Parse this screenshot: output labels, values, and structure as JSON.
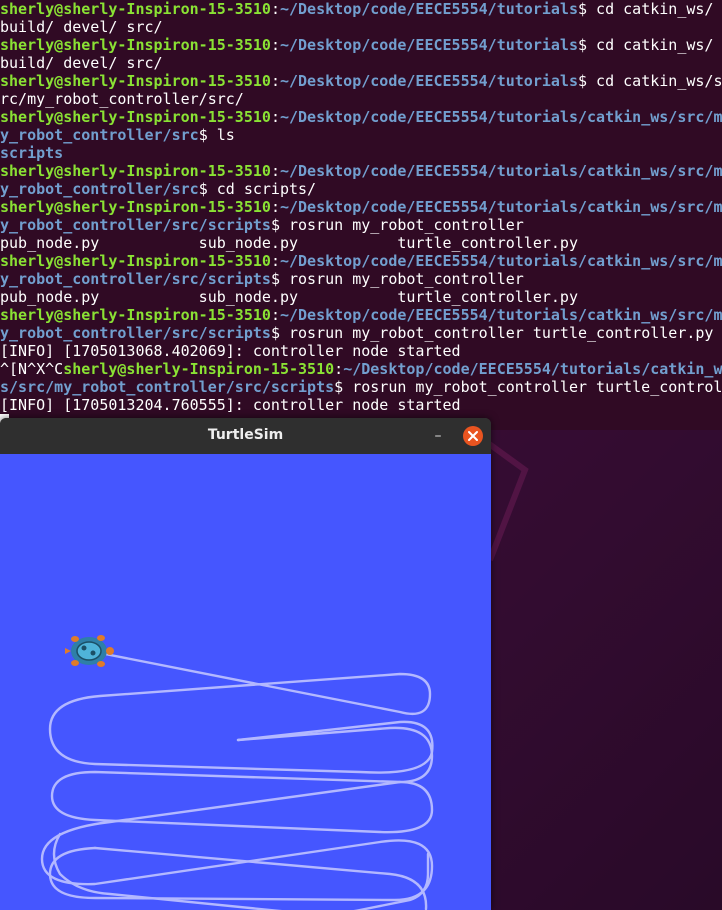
{
  "terminal": {
    "prompt_user": "sherly@sherly-Inspiron-15-3510",
    "lines": [
      [
        {
          "t": "sherly@sherly-Inspiron-15-3510",
          "c": "user"
        },
        {
          "t": ":",
          "c": "plain"
        },
        {
          "t": "~/Desktop/code/EECE5554/tutorials",
          "c": "path"
        },
        {
          "t": "$ cd catkin_ws/",
          "c": "plain"
        }
      ],
      [
        {
          "t": "build/ devel/ src/",
          "c": "plain"
        }
      ],
      [
        {
          "t": "sherly@sherly-Inspiron-15-3510",
          "c": "user"
        },
        {
          "t": ":",
          "c": "plain"
        },
        {
          "t": "~/Desktop/code/EECE5554/tutorials",
          "c": "path"
        },
        {
          "t": "$ cd catkin_ws/",
          "c": "plain"
        }
      ],
      [
        {
          "t": "build/ devel/ src/",
          "c": "plain"
        }
      ],
      [
        {
          "t": "sherly@sherly-Inspiron-15-3510",
          "c": "user"
        },
        {
          "t": ":",
          "c": "plain"
        },
        {
          "t": "~/Desktop/code/EECE5554/tutorials",
          "c": "path"
        },
        {
          "t": "$ cd catkin_ws/s",
          "c": "plain"
        }
      ],
      [
        {
          "t": "rc/my_robot_controller/src/",
          "c": "plain"
        }
      ],
      [
        {
          "t": "sherly@sherly-Inspiron-15-3510",
          "c": "user"
        },
        {
          "t": ":",
          "c": "plain"
        },
        {
          "t": "~/Desktop/code/EECE5554/tutorials/catkin_ws/src/m",
          "c": "path"
        }
      ],
      [
        {
          "t": "y_robot_controller/src",
          "c": "path"
        },
        {
          "t": "$ ls",
          "c": "plain"
        }
      ],
      [
        {
          "t": "scripts",
          "c": "dir"
        }
      ],
      [
        {
          "t": "sherly@sherly-Inspiron-15-3510",
          "c": "user"
        },
        {
          "t": ":",
          "c": "plain"
        },
        {
          "t": "~/Desktop/code/EECE5554/tutorials/catkin_ws/src/m",
          "c": "path"
        }
      ],
      [
        {
          "t": "y_robot_controller/src",
          "c": "path"
        },
        {
          "t": "$ cd scripts/",
          "c": "plain"
        }
      ],
      [
        {
          "t": "sherly@sherly-Inspiron-15-3510",
          "c": "user"
        },
        {
          "t": ":",
          "c": "plain"
        },
        {
          "t": "~/Desktop/code/EECE5554/tutorials/catkin_ws/src/m",
          "c": "path"
        }
      ],
      [
        {
          "t": "y_robot_controller/src/scripts",
          "c": "path"
        },
        {
          "t": "$ rosrun my_robot_controller",
          "c": "plain"
        }
      ],
      [
        {
          "t": "pub_node.py           sub_node.py           turtle_controller.py",
          "c": "plain"
        }
      ],
      [
        {
          "t": "sherly@sherly-Inspiron-15-3510",
          "c": "user"
        },
        {
          "t": ":",
          "c": "plain"
        },
        {
          "t": "~/Desktop/code/EECE5554/tutorials/catkin_ws/src/m",
          "c": "path"
        }
      ],
      [
        {
          "t": "y_robot_controller/src/scripts",
          "c": "path"
        },
        {
          "t": "$ rosrun my_robot_controller",
          "c": "plain"
        }
      ],
      [
        {
          "t": "pub_node.py           sub_node.py           turtle_controller.py",
          "c": "plain"
        }
      ],
      [
        {
          "t": "sherly@sherly-Inspiron-15-3510",
          "c": "user"
        },
        {
          "t": ":",
          "c": "plain"
        },
        {
          "t": "~/Desktop/code/EECE5554/tutorials/catkin_ws/src/m",
          "c": "path"
        }
      ],
      [
        {
          "t": "y_robot_controller/src/scripts",
          "c": "path"
        },
        {
          "t": "$ rosrun my_robot_controller turtle_controller.py",
          "c": "plain"
        }
      ],
      [
        {
          "t": "[INFO] [1705013068.402069]: controller node started",
          "c": "plain"
        }
      ],
      [
        {
          "t": "^[N^X^C",
          "c": "plain"
        },
        {
          "t": "sherly@sherly-Inspiron-15-3510",
          "c": "user"
        },
        {
          "t": ":",
          "c": "plain"
        },
        {
          "t": "~/Desktop/code/EECE5554/tutorials/catkin_w",
          "c": "path"
        }
      ],
      [
        {
          "t": "s/src/my_robot_controller/src/scripts",
          "c": "path"
        },
        {
          "t": "$ rosrun my_robot_controller turtle_controll",
          "c": "plain"
        }
      ],
      [
        {
          "t": "[INFO] [1705013204.760555]: controller node started",
          "c": "plain"
        }
      ]
    ]
  },
  "turtlesim": {
    "title": "TurtleSim",
    "minimize_label": "–",
    "close_label": "×",
    "background_color": "#4556ff",
    "pen_color": "#b3b8ff"
  },
  "desktop": {
    "accent_color": "#e95420"
  }
}
